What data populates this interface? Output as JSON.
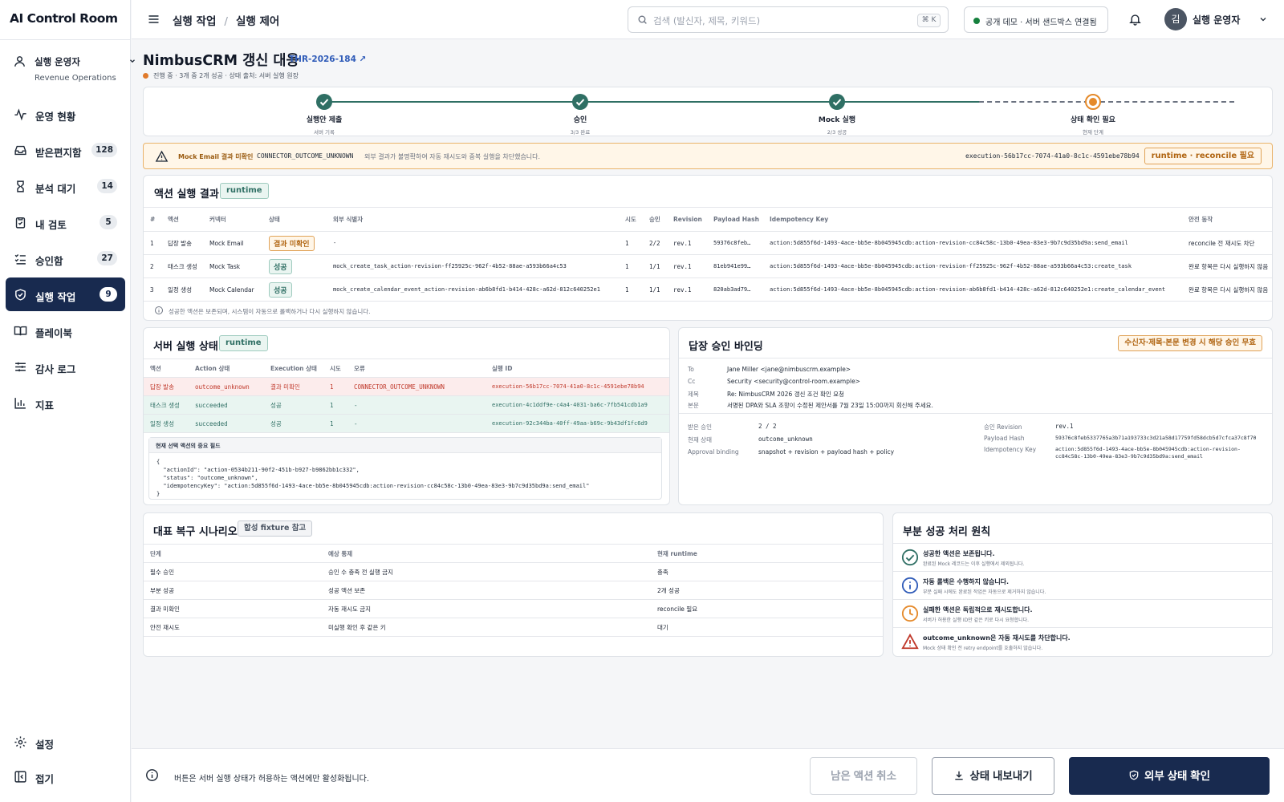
{
  "app": {
    "logo": "AI Control Room"
  },
  "sidebar": {
    "user": {
      "name": "실행 운영자",
      "team": "Revenue Operations"
    },
    "items": [
      {
        "label": "운영 현황",
        "count": null
      },
      {
        "label": "받은편지함",
        "count": "128"
      },
      {
        "label": "분석 대기",
        "count": "14"
      },
      {
        "label": "내 검토",
        "count": "5"
      },
      {
        "label": "승인함",
        "count": "27"
      },
      {
        "label": "실행 작업",
        "count": "9"
      },
      {
        "label": "플레이북",
        "count": null
      },
      {
        "label": "감사 로그",
        "count": null
      },
      {
        "label": "지표",
        "count": null
      }
    ],
    "settings": "설정",
    "collapse": "접기"
  },
  "topbar": {
    "crumb1": "실행 작업",
    "crumb_sep": "/",
    "crumb2": "실행 제어",
    "search_placeholder": "검색 (발신자, 제목, 키워드)",
    "search_shortcut": "⌘ K",
    "connection": "공개 데모 · 서버 샌드박스 연결됨",
    "avatar": "김",
    "account": "실행 운영자"
  },
  "page": {
    "title": "NimbusCRM 갱신 대응",
    "ticket": "THR-2026-184 ↗",
    "status": "진행 중 · 3개 중 2개 성공 · 상태 출처: 서버 실행 원장"
  },
  "stepper": [
    {
      "title": "실행안 제출",
      "sub": "서버 기록"
    },
    {
      "title": "승인",
      "sub": "3/3 완료"
    },
    {
      "title": "Mock 실행",
      "sub": "2/3 성공"
    },
    {
      "title": "상태 확인 필요",
      "sub": "현재 단계"
    }
  ],
  "warning": {
    "title": "Mock Email 결과 미확인",
    "code": "CONNECTOR_OUTCOME_UNKNOWN",
    "desc": "외부 결과가 불명확하여 자동 재시도와 중복 실행을 차단했습니다.",
    "execution": "execution-56b17cc-7074-41a0-8c1c-4591ebe78b94",
    "badge": "runtime · reconcile 필요"
  },
  "results": {
    "title": "액션 실행 결과",
    "tag": "runtime",
    "headers": [
      "#",
      "액션",
      "커넥터",
      "상태",
      "외부 식별자",
      "시도",
      "승인",
      "Revision",
      "Payload Hash",
      "Idempotency Key",
      "안전 동작"
    ],
    "rows": [
      {
        "n": "1",
        "action": "답장 발송",
        "connector": "Mock Email",
        "status": "결과 미확인",
        "kind": "warn",
        "ext": "-",
        "tries": "1",
        "approval": "2/2",
        "rev": "rev.1",
        "hash": "59376c8feb…",
        "key": "action:5d855f6d-1493-4ace-bb5e-8b045945cdb:action-revision-cc84c58c-13b0-49ea-83e3-9b7c9d35bd9a:send_email",
        "safe": "reconcile 전 재시도 차단"
      },
      {
        "n": "2",
        "action": "태스크 생성",
        "connector": "Mock Task",
        "status": "성공",
        "kind": "ok",
        "ext": "mock_create_task_action-revision-ff25925c-962f-4b52-88ae-a593b66a4c53",
        "tries": "1",
        "approval": "1/1",
        "rev": "rev.1",
        "hash": "81eb941e99…",
        "key": "action:5d855f6d-1493-4ace-bb5e-8b045945cdb:action-revision-ff25925c-962f-4b52-88ae-a593b66a4c53:create_task",
        "safe": "완료 항목은 다시 실행하지 않음"
      },
      {
        "n": "3",
        "action": "일정 생성",
        "connector": "Mock Calendar",
        "status": "성공",
        "kind": "ok",
        "ext": "mock_create_calendar_event_action-revision-ab6b8fd1-b414-428c-a62d-812c640252e1",
        "tries": "1",
        "approval": "1/1",
        "rev": "rev.1",
        "hash": "820ab3ad79…",
        "key": "action:5d855f6d-1493-4ace-bb5e-8b045945cdb:action-revision-ab6b8fd1-b414-428c-a62d-812c640252e1:create_calendar_event",
        "safe": "완료 항목은 다시 실행하지 않음"
      }
    ],
    "note": "성공한 액션은 보존되며, 시스템이 자동으로 롤백하거나 다시 실행하지 않습니다."
  },
  "server": {
    "title": "서버 실행 상태",
    "tag": "runtime",
    "headers": [
      "액션",
      "Action 상태",
      "Execution 상태",
      "시도",
      "오류",
      "실행 ID"
    ],
    "rows": [
      {
        "action": "답장 발송",
        "astate": "outcome_unknown",
        "estate": "결과 미확인",
        "tries": "1",
        "err": "CONNECTOR_OUTCOME_UNKNOWN",
        "id": "execution-56b17cc-7074-41a0-8c1c-4591ebe78b94",
        "kind": "warn"
      },
      {
        "action": "태스크 생성",
        "astate": "succeeded",
        "estate": "성공",
        "tries": "1",
        "err": "-",
        "id": "execution-4c1ddf9e-c4a4-4031-ba6c-7fb541cdb1a9",
        "kind": "ok"
      },
      {
        "action": "일정 생성",
        "astate": "succeeded",
        "estate": "성공",
        "tries": "1",
        "err": "-",
        "id": "execution-92c344ba-40ff-49aa-b69c-9b43df1fc6d9",
        "kind": "ok"
      }
    ],
    "code_header": "현재 선택 액션의 중요 필드",
    "code": "{\n  \"actionId\": \"action-0534b211-90f2-451b-b927-b9862bb1c332\",\n  \"status\": \"outcome_unknown\",\n  \"idempotencyKey\": \"action:5d855f6d-1493-4ace-bb5e-8b045945cdb:action-revision-cc84c58c-13b0-49ea-83e3-9b7c9d35bd9a:send_email\"\n}"
  },
  "binding": {
    "title": "답장 승인 바인딩",
    "tag": "수신자·제목·본문 변경 시 해당 승인 무효",
    "mail": [
      {
        "k": "To",
        "v": "Jane Miller <jane@nimbuscrm.example>"
      },
      {
        "k": "Cc",
        "v": "Security <security@control-room.example>"
      },
      {
        "k": "제목",
        "v": "Re: NimbusCRM 2026 갱신 조건 확인 요청"
      },
      {
        "k": "본문",
        "v": "서명된 DPA와 SLA 조항이 수정된 제안서를 7월 23일 15:00까지 회신해 주세요."
      }
    ],
    "left": [
      {
        "k": "받은 승인",
        "v": "2 / 2"
      },
      {
        "k": "현재 상태",
        "v": "outcome_unknown"
      },
      {
        "k": "Approval binding",
        "v": "snapshot + revision + payload hash + policy"
      }
    ],
    "right": [
      {
        "k": "승인 Revision",
        "v": "rev.1"
      },
      {
        "k": "Payload Hash",
        "v": "59376c8feb5337765a3b71a193733c3d21a58d17759fd58dcb5d7cfca37c8f70"
      },
      {
        "k": "Idempotency Key",
        "v": "action:5d855f6d-1493-4ace-bb5e-8b045945cdb:action-revision-",
        "v2": "cc84c58c-13b0-49ea-83e3-9b7c9d35bd9a:send_email"
      }
    ]
  },
  "scenario": {
    "title": "대표 복구 시나리오",
    "tag": "합성 fixture 참고",
    "headers": [
      "단계",
      "예상 통제",
      "현재 runtime"
    ],
    "rows": [
      [
        "필수 승인",
        "승인 수 충족 전 실행 금지",
        "충족"
      ],
      [
        "부분 성공",
        "성공 액션 보존",
        "2개 성공"
      ],
      [
        "결과 미확인",
        "자동 재시도 금지",
        "reconcile 필요"
      ],
      [
        "안전 재시도",
        "미실행 확인 후 같은 키",
        "대기"
      ]
    ]
  },
  "principles": {
    "title": "부분 성공 처리 원칙",
    "items": [
      {
        "t": "성공한 액션은 보존됩니다.",
        "s": "완료된 Mock 레코드는 이후 실행에서 제외됩니다."
      },
      {
        "t": "자동 롤백은 수행하지 않습니다.",
        "s": "부분 실패 시에도 완료된 작업은 자동으로 제거하지 않습니다."
      },
      {
        "t": "실패한 액션은 독립적으로 재시도합니다.",
        "s": "서버가 허용한 실행 ID만 같은 키로 다시 요청합니다."
      },
      {
        "t": "outcome_unknown은 자동 재시도를 차단합니다.",
        "s": "Mock 상태 확인 전 retry endpoint를 호출하지 않습니다."
      }
    ]
  },
  "footer": {
    "note": "버튼은 서버 실행 상태가 허용하는 액션에만 활성화됩니다.",
    "cancel": "남은 액션 취소",
    "export": "상태 내보내기",
    "confirm": "외부 상태 확인"
  },
  "colors": {
    "primary": "#182a4f",
    "success": "#2f6f64",
    "warning": "#e07a2b",
    "danger": "#c0392b"
  }
}
